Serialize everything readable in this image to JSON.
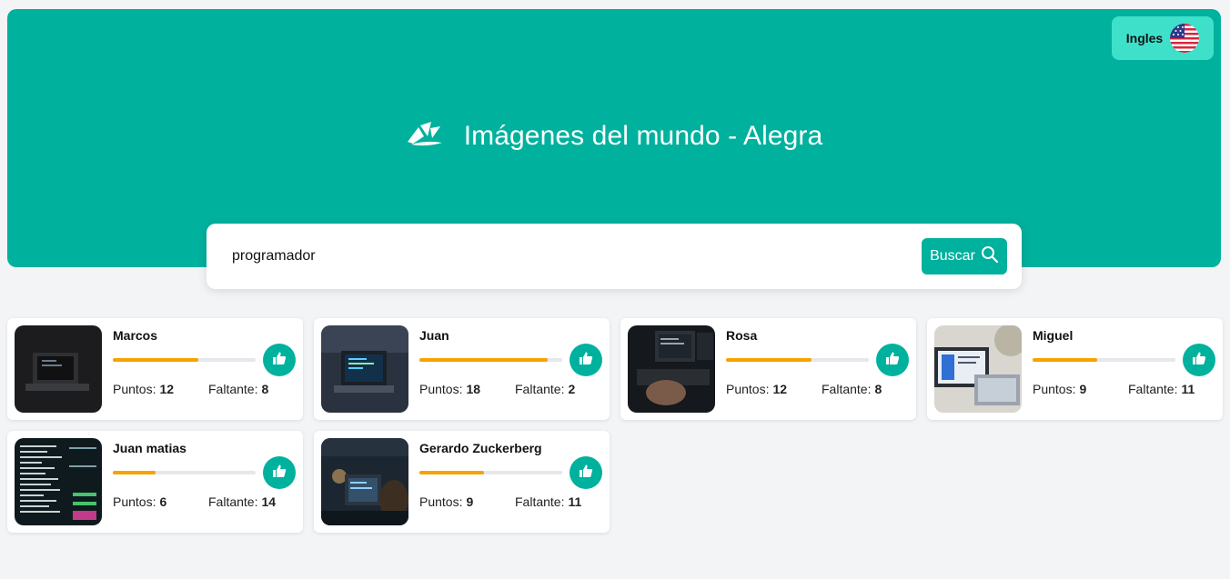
{
  "header": {
    "title": "Imágenes del mundo - Alegra",
    "logo_icon": "alegra-logo-icon",
    "language_button": {
      "label": "Ingles",
      "icon": "us-flag-icon"
    },
    "background_color": "#00b19d",
    "accent_light": "#3ee0c9"
  },
  "search": {
    "value": "programador",
    "placeholder": "",
    "button_label": "Buscar",
    "button_icon": "search-icon"
  },
  "sellers": [
    {
      "name": "Marcos",
      "points_label": "Puntos:",
      "points": "12",
      "missing_label": "Faltante:",
      "missing": "8",
      "progress": 0.6,
      "image": "laptop-dark-photo"
    },
    {
      "name": "Juan",
      "points_label": "Puntos:",
      "points": "18",
      "missing_label": "Faltante:",
      "missing": "2",
      "progress": 0.9,
      "image": "laptop-code-photo"
    },
    {
      "name": "Rosa",
      "points_label": "Puntos:",
      "points": "12",
      "missing_label": "Faltante:",
      "missing": "8",
      "progress": 0.6,
      "image": "keyboard-monitors-photo"
    },
    {
      "name": "Miguel",
      "points_label": "Puntos:",
      "points": "9",
      "missing_label": "Faltante:",
      "missing": "11",
      "progress": 0.45,
      "image": "laptop-desk-photo"
    },
    {
      "name": "Juan matias",
      "points_label": "Puntos:",
      "points": "6",
      "missing_label": "Faltante:",
      "missing": "14",
      "progress": 0.3,
      "image": "terminal-screen-photo"
    },
    {
      "name": "Gerardo Zuckerberg",
      "points_label": "Puntos:",
      "points": "9",
      "missing_label": "Faltante:",
      "missing": "11",
      "progress": 0.45,
      "image": "developer-night-photo"
    }
  ],
  "colors": {
    "progress_fill": "#f5a300",
    "progress_track": "#e5e7eb",
    "like_button": "#00b19d"
  }
}
